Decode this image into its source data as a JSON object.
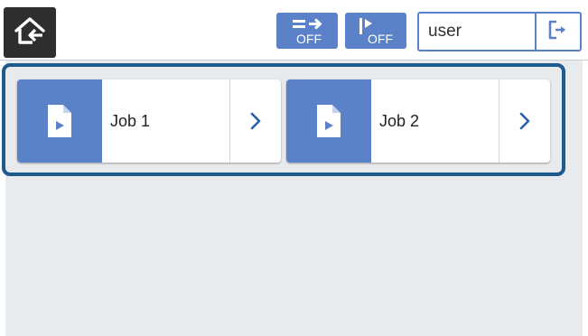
{
  "header": {
    "home_icon": "home-icon",
    "status_buttons": [
      {
        "icon": "continuous-scan-off-icon",
        "label": "OFF"
      },
      {
        "icon": "skip-blank-off-icon",
        "label": "OFF"
      }
    ],
    "user_label": "user",
    "logout_icon": "logout-icon"
  },
  "jobs": [
    {
      "label": "Job 1",
      "icon": "document-play-icon"
    },
    {
      "label": "Job 2",
      "icon": "document-play-icon"
    }
  ],
  "colors": {
    "accent": "#5b82c9",
    "frame": "#1d5a8e",
    "background": "#e8ebee",
    "home_bg": "#2e2e2e"
  }
}
